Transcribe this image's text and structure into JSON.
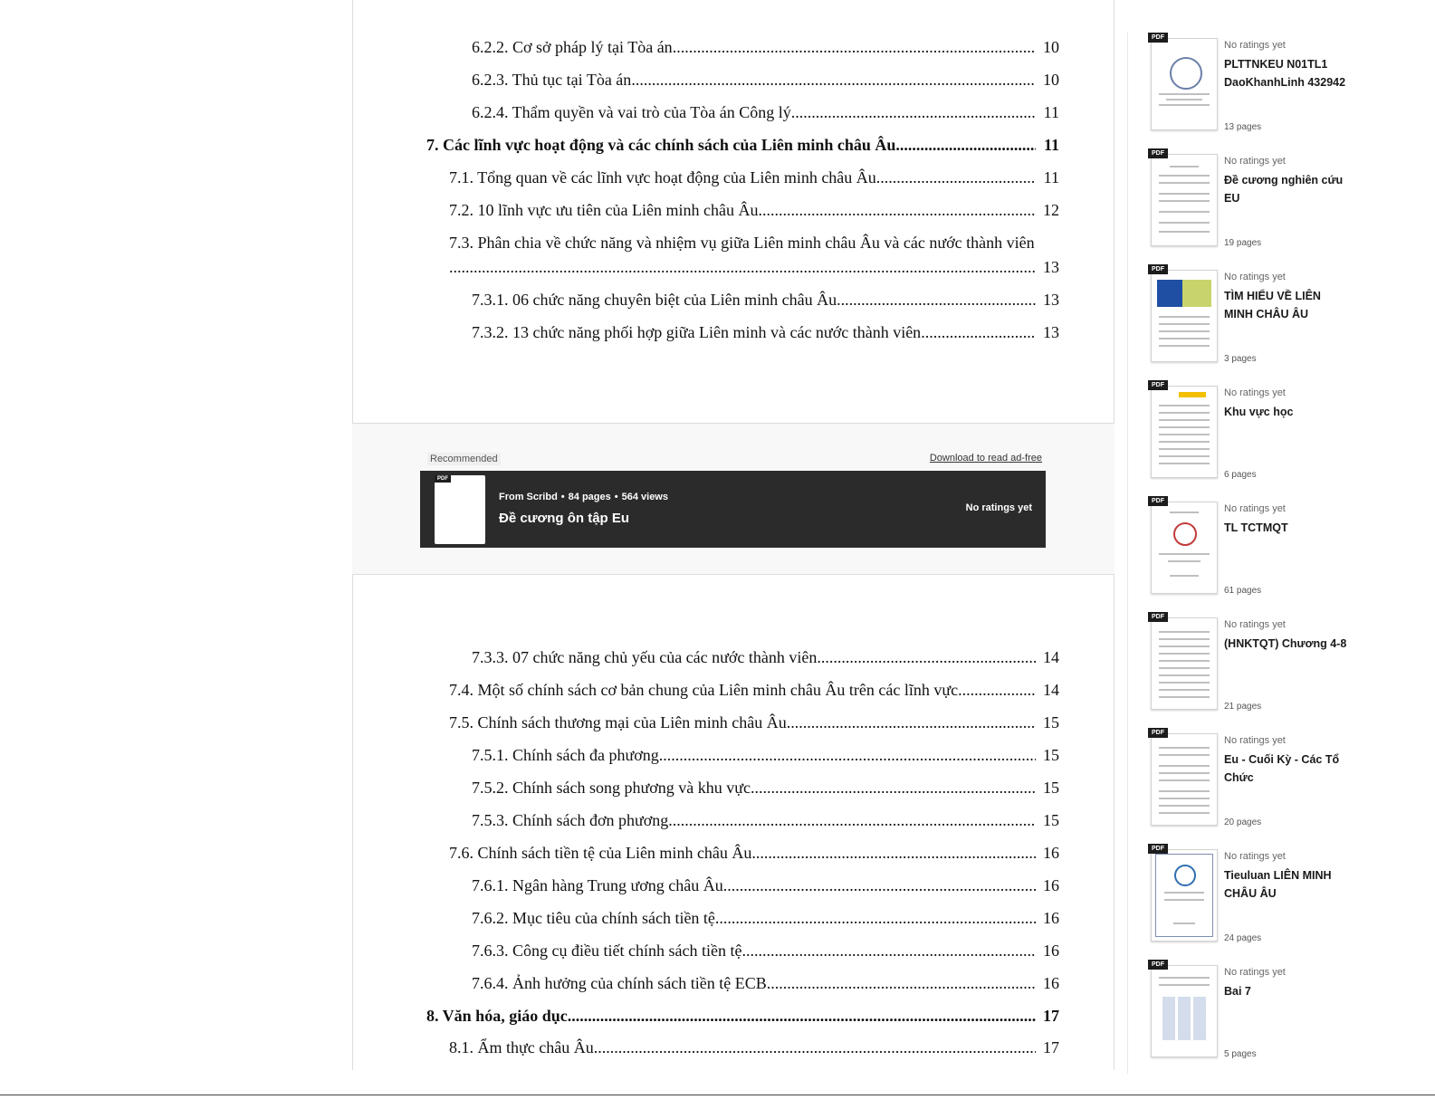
{
  "toc": {
    "page1": [
      {
        "level": 3,
        "text": "6.2.2. Cơ sở pháp lý tại Tòa án",
        "page": "10"
      },
      {
        "level": 3,
        "text": "6.2.3. Thủ tục tại Tòa án",
        "page": "10"
      },
      {
        "level": 3,
        "text": "6.2.4. Thẩm quyền và vai trò của Tòa án Công lý",
        "page": "11"
      },
      {
        "level": 1,
        "text": "7. Các lĩnh vực hoạt động và các chính sách của Liên minh châu Âu",
        "page": "11"
      },
      {
        "level": 2,
        "text": "7.1. Tổng quan về các lĩnh vực hoạt động của Liên minh châu Âu",
        "page": "11"
      },
      {
        "level": 2,
        "text": "7.2. 10 lĩnh vực ưu tiên của Liên minh châu Âu",
        "page": "12"
      },
      {
        "level": 2,
        "text": "7.3. Phân chia về chức năng và nhiệm vụ giữa Liên minh châu Âu và các nước thành viên",
        "page": "13"
      },
      {
        "level": 3,
        "text": "7.3.1. 06 chức năng chuyên biệt của Liên minh châu Âu",
        "page": "13"
      },
      {
        "level": 3,
        "text": "7.3.2. 13 chức năng phối hợp giữa Liên minh và các nước thành viên",
        "page": "13"
      }
    ],
    "page2": [
      {
        "level": 3,
        "text": "7.3.3. 07 chức năng chủ yếu của các nước thành viên",
        "page": "14"
      },
      {
        "level": 2,
        "text": "7.4. Một số chính sách cơ bản chung của Liên minh châu Âu trên các lĩnh vực",
        "page": "14"
      },
      {
        "level": 2,
        "text": "7.5. Chính sách thương mại của Liên minh châu Âu",
        "page": "15"
      },
      {
        "level": 3,
        "text": "7.5.1. Chính sách đa phương",
        "page": "15"
      },
      {
        "level": 3,
        "text": "7.5.2. Chính sách song phương và khu vực",
        "page": "15"
      },
      {
        "level": 3,
        "text": "7.5.3. Chính sách đơn phương",
        "page": "15"
      },
      {
        "level": 2,
        "text": "7.6. Chính sách tiền tệ của Liên minh châu Âu",
        "page": "16"
      },
      {
        "level": 3,
        "text": "7.6.1. Ngân hàng Trung ương châu Âu",
        "page": "16"
      },
      {
        "level": 3,
        "text": "7.6.2. Mục tiêu của chính sách tiền tệ",
        "page": "16"
      },
      {
        "level": 3,
        "text": "7.6.3. Công cụ điều tiết chính sách tiền tệ",
        "page": "16"
      },
      {
        "level": 3,
        "text": "7.6.4. Ảnh hưởng của chính sách tiền tệ ECB",
        "page": "16"
      },
      {
        "level": 1,
        "text": "8. Văn hóa, giáo dục",
        "page": "17"
      },
      {
        "level": 2,
        "text": "8.1. Ẩm thực châu Âu",
        "page": "17"
      }
    ]
  },
  "recommended": {
    "label": "Recommended",
    "download_link": "Download to read ad-free",
    "pdf_tag": "PDF",
    "source": "From Scribd",
    "pages": "84 pages",
    "views": "564 views",
    "title": "Đề cương ôn tập Eu",
    "rating": "No ratings yet",
    "background_color": "#2b2b2b"
  },
  "sidebar": {
    "items": [
      {
        "rating": "No ratings yet",
        "title": "PLTTNKEU N01TL1 DaoKhanhLinh 432942",
        "pages": "13 pages",
        "thumb": "seal"
      },
      {
        "rating": "No ratings yet",
        "title": "Đề cương nghiên cứu EU",
        "pages": "19 pages",
        "thumb": "form"
      },
      {
        "rating": "No ratings yet",
        "title": "TÌM HIỂU VỀ LIÊN MINH CHÂU ÂU",
        "pages": "3 pages",
        "thumb": "eu-map"
      },
      {
        "rating": "No ratings yet",
        "title": "Khu vực học",
        "pages": "6 pages",
        "thumb": "text-yellow"
      },
      {
        "rating": "No ratings yet",
        "title": "TL TCTMQT",
        "pages": "61 pages",
        "thumb": "cover-seal"
      },
      {
        "rating": "No ratings yet",
        "title": "(HNKTQT) Chương 4-8",
        "pages": "21 pages",
        "thumb": "text"
      },
      {
        "rating": "No ratings yet",
        "title": "Eu - Cuối Kỳ - Các Tổ Chức",
        "pages": "20 pages",
        "thumb": "text"
      },
      {
        "rating": "No ratings yet",
        "title": "Tieuluan LIÊN MINH CHÂU ÂU",
        "pages": "24 pages",
        "thumb": "framed-seal"
      },
      {
        "rating": "No ratings yet",
        "title": "Bai 7",
        "pages": "5 pages",
        "thumb": "grid"
      }
    ],
    "pdf_tag": "PDF"
  }
}
